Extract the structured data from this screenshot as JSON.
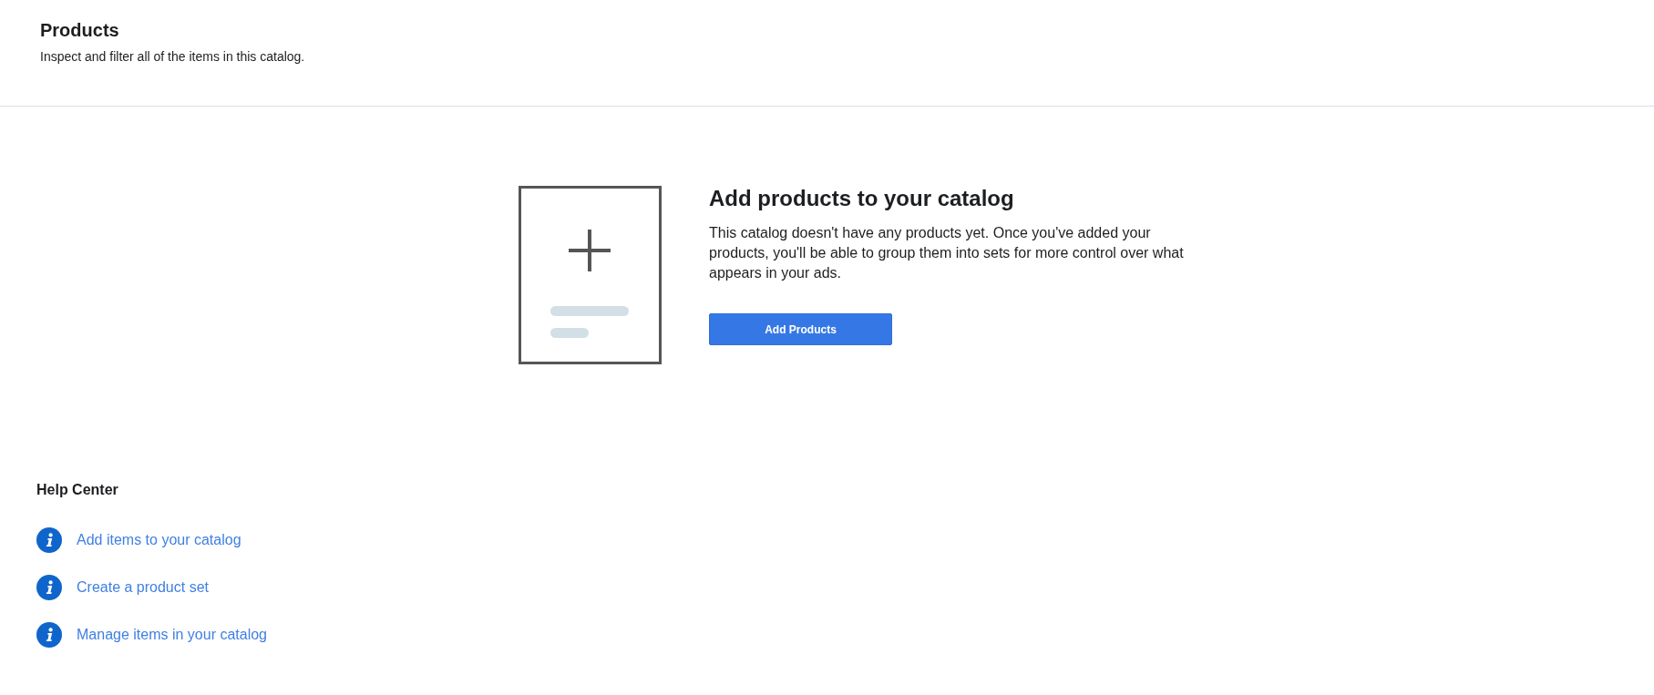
{
  "header": {
    "title": "Products",
    "subtitle": "Inspect and filter all of the items in this catalog."
  },
  "empty_state": {
    "heading": "Add products to your catalog",
    "body": "This catalog doesn't have any products yet. Once you've added your\nproducts, you'll be able to group them into sets for more control over what appears in your ads.",
    "button": "Add Products"
  },
  "help_center": {
    "title": "Help Center",
    "links": [
      {
        "label": "Add items to your catalog"
      },
      {
        "label": "Create a product set"
      },
      {
        "label": "Manage items in your catalog"
      }
    ]
  }
}
